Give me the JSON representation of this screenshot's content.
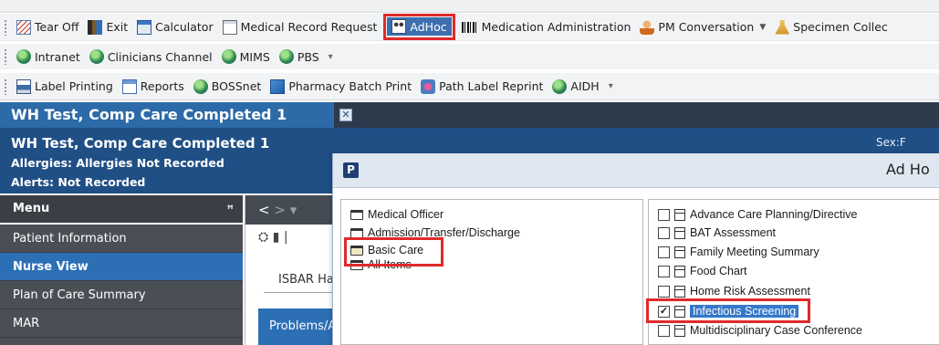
{
  "toolbar1": {
    "items": [
      {
        "label": "Tear Off",
        "icon": "tear-off-icon"
      },
      {
        "label": "Exit",
        "icon": "exit-icon"
      },
      {
        "label": "Calculator",
        "icon": "calculator-icon"
      },
      {
        "label": "Medical Record Request",
        "icon": "medical-record-icon"
      },
      {
        "label": "AdHoc",
        "icon": "adhoc-icon"
      },
      {
        "label": "Medication Administration",
        "icon": "barcode-icon"
      },
      {
        "label": "PM Conversation",
        "icon": "person-icon"
      },
      {
        "label": "Specimen Collec",
        "icon": "specimen-icon"
      }
    ]
  },
  "toolbar2": {
    "items": [
      {
        "label": "Intranet",
        "icon": "globe-icon"
      },
      {
        "label": "Clinicians Channel",
        "icon": "globe-icon"
      },
      {
        "label": "MIMS",
        "icon": "globe-icon"
      },
      {
        "label": "PBS",
        "icon": "globe-icon"
      }
    ]
  },
  "toolbar3": {
    "items": [
      {
        "label": "Label Printing",
        "icon": "label-printer-icon"
      },
      {
        "label": "Reports",
        "icon": "reports-icon"
      },
      {
        "label": "BOSSnet",
        "icon": "globe-icon"
      },
      {
        "label": "Pharmacy Batch Print",
        "icon": "pharmacy-icon"
      },
      {
        "label": "Path Label Reprint",
        "icon": "path-label-icon"
      },
      {
        "label": "AIDH",
        "icon": "globe-icon"
      }
    ]
  },
  "patient_tab": {
    "title": "WH Test, Comp Care Completed 1",
    "close_glyph": "✕"
  },
  "banner": {
    "name": "WH Test, Comp Care Completed 1",
    "allergies": "Allergies: Allergies Not Recorded",
    "alerts": "Alerts: Not Recorded",
    "sex": "Sex:F"
  },
  "menu": {
    "title": "Menu",
    "pin_glyph": "ꟸ",
    "items": [
      {
        "label": "Patient Information"
      },
      {
        "label": "Nurse View"
      },
      {
        "label": "Plan of Care Summary"
      },
      {
        "label": "MAR"
      }
    ],
    "active_index": 1
  },
  "content": {
    "back_glyph": "<",
    "forward_glyph": ">",
    "isbar_label": "ISBAR Ha",
    "problems_tab": "Problems/A"
  },
  "dialog": {
    "icon_letter": "P",
    "title": "Ad Ho",
    "folders": [
      {
        "label": "Medical Officer"
      },
      {
        "label": "Admission/Transfer/Discharge"
      },
      {
        "label": "Basic Care"
      },
      {
        "label": "All Items"
      }
    ],
    "forms": [
      {
        "label": "Advance Care Planning/Directive",
        "checked": false
      },
      {
        "label": "BAT Assessment",
        "checked": false
      },
      {
        "label": "Family Meeting Summary",
        "checked": false
      },
      {
        "label": "Food Chart",
        "checked": false
      },
      {
        "label": "Home Risk Assessment",
        "checked": false
      },
      {
        "label": "Infectious Screening",
        "checked": true
      },
      {
        "label": "Multidisciplinary Case Conference",
        "checked": false
      }
    ]
  },
  "colors": {
    "highlight_red": "#e02a2a",
    "accent_blue": "#2c6fb5",
    "banner_blue": "#1f4f85"
  }
}
